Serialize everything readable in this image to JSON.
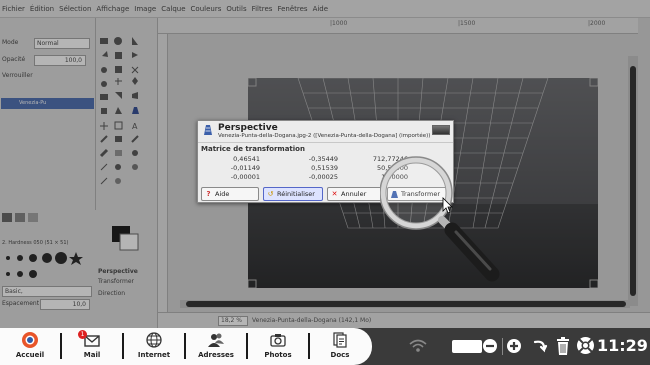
{
  "menubar": {
    "items": [
      "Fichier",
      "Édition",
      "Sélection",
      "Affichage",
      "Image",
      "Calque",
      "Couleurs",
      "Outils",
      "Filtres",
      "Fenêtres",
      "Aide"
    ]
  },
  "layers_panel": {
    "mode_label": "Mode",
    "mode_value": "Normal",
    "opacity_label": "Opacité",
    "opacity_value": "100,0",
    "lock_label": "Verrouiller",
    "layer_name": "Venezia-Pu"
  },
  "brush_panel": {
    "brush_name": "2. Hardness 050 (51 × 51)",
    "preset": "Basic,",
    "spacing_label": "Espacement",
    "spacing_value": "10,0"
  },
  "tool_options": {
    "title": "Perspective",
    "transform_label": "Transformer",
    "direction_label": "Direction"
  },
  "canvas": {
    "ruler_marks": [
      "|1000",
      "|1500",
      "|2000"
    ],
    "zoom": "18,2 %",
    "status": "Venezia-Punta-della-Dogana (142,1 Mo)"
  },
  "dialog": {
    "title": "Perspective",
    "subtitle": "Venezia-Punta-della-Dogana.jpg-2 ([Venezia-Punta-della-Dogana] (importée))",
    "matrix_heading": "Matrice de transformation",
    "matrix": [
      [
        "0,46541",
        "-0,35449",
        "712,77246"
      ],
      [
        "-0,01149",
        "0,51539",
        "50,50000"
      ],
      [
        "-0,00001",
        "-0,00025",
        "1,00000"
      ]
    ],
    "buttons": {
      "help": "Aide",
      "reset": "Réinitialiser",
      "cancel": "Annuler",
      "transform": "Transformer"
    }
  },
  "taskbar": {
    "items": [
      {
        "label": "Accueil",
        "icon": "home-logo-icon"
      },
      {
        "label": "Mail",
        "icon": "mail-icon",
        "badge": "1"
      },
      {
        "label": "Internet",
        "icon": "globe-icon"
      },
      {
        "label": "Adresses",
        "icon": "contacts-icon"
      },
      {
        "label": "Photos",
        "icon": "camera-icon"
      },
      {
        "label": "Docs",
        "icon": "documents-icon"
      }
    ],
    "clock": "11:29"
  },
  "colors": {
    "taskbar_dark": "#3a3a3a",
    "dialog_active_button": "#dde3ff",
    "layer_selected": "#3b5faa"
  }
}
